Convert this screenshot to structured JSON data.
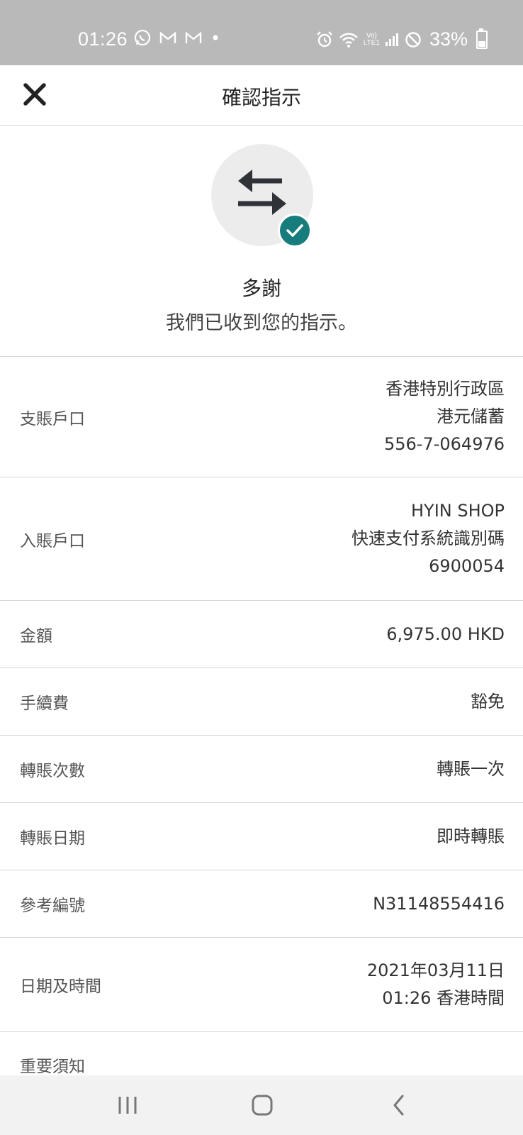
{
  "status_bar": {
    "time": "01:26",
    "left_icons": [
      "whatsapp-icon",
      "gmail-icon",
      "gmail-icon",
      "dot-icon"
    ],
    "right_icons": [
      "alarm-icon",
      "wifi-icon",
      "volte-lte-icon",
      "signal-icon",
      "do-not-disturb-icon"
    ],
    "volte_label": "Vo)",
    "lte_label": "LTE1",
    "battery": "33%",
    "battery_level": 0.33,
    "background_color": "#b9b9b9"
  },
  "header": {
    "title": "確認指示",
    "close_icon": "close-icon"
  },
  "hero": {
    "icon": "transfer-arrows-icon",
    "badge_icon": "check-icon",
    "badge_color": "#177c7c",
    "title": "多謝",
    "subtitle": "我們已收到您的指示。"
  },
  "details": [
    {
      "label": "支賬戶口",
      "values": [
        "香港特別行政區",
        "港元儲蓄",
        "556-7-064976"
      ]
    },
    {
      "label": "入賬戶口",
      "values": [
        "HYIN SHOP",
        "快速支付系統識別碼",
        "6900054"
      ]
    },
    {
      "label": "金額",
      "values": [
        "6,975.00 HKD"
      ]
    },
    {
      "label": "手續費",
      "values": [
        "豁免"
      ]
    },
    {
      "label": "轉賬次數",
      "values": [
        "轉賬一次"
      ]
    },
    {
      "label": "轉賬日期",
      "values": [
        "即時轉賬"
      ]
    },
    {
      "label": "參考編號",
      "values": [
        "N31148554416"
      ]
    },
    {
      "label": "日期及時間",
      "values": [
        "2021年03月11日",
        "01:26 香港時間"
      ]
    }
  ],
  "notice": {
    "label": "重要須知"
  },
  "nav_bar": {
    "recent_icon": "recent-apps-icon",
    "home_icon": "home-icon",
    "back_icon": "back-icon"
  }
}
